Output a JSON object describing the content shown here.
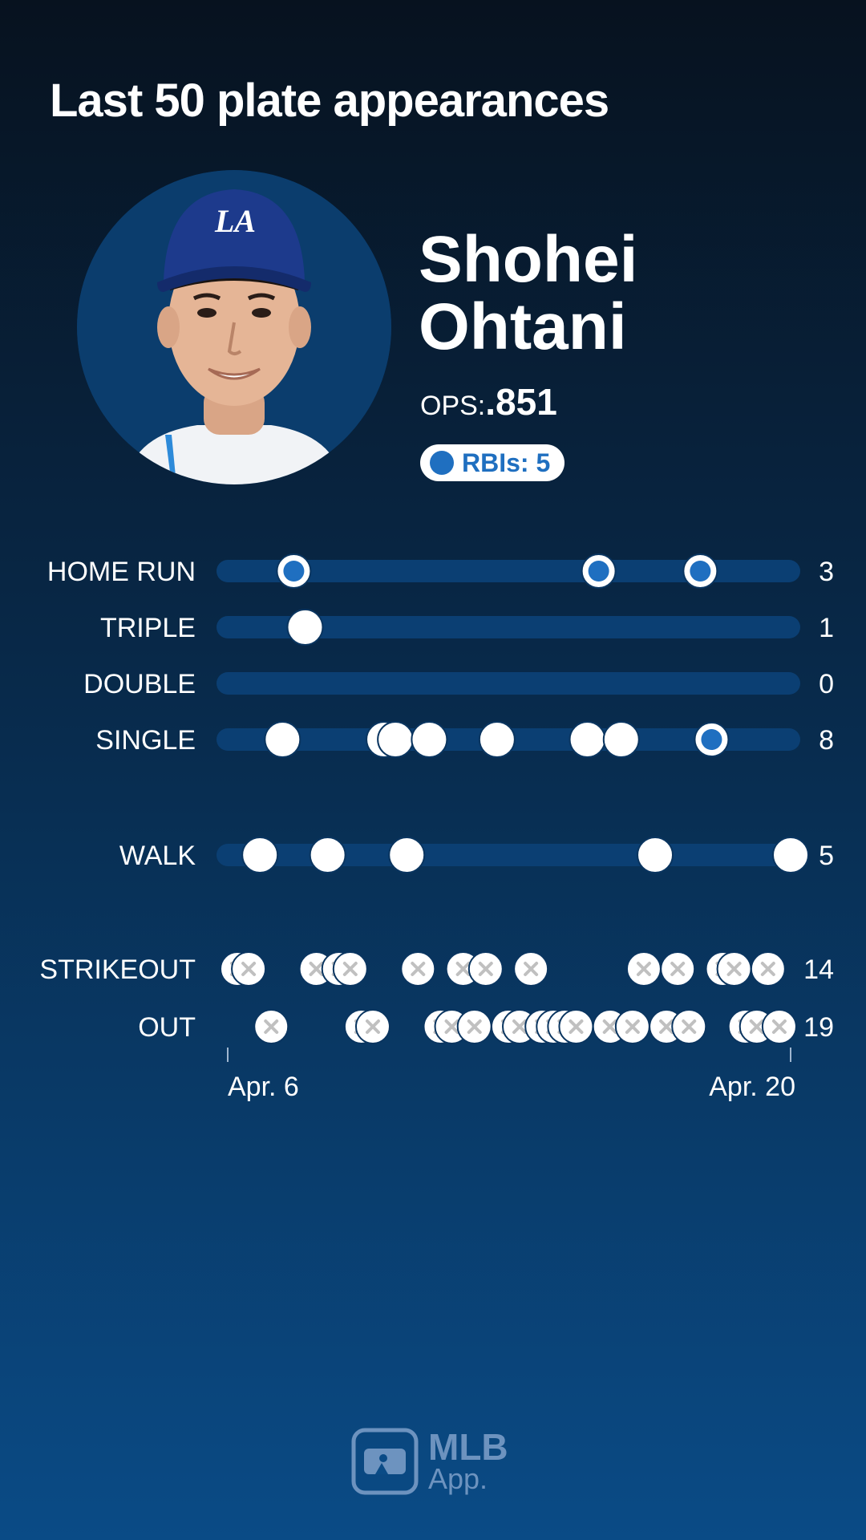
{
  "header": {
    "title": "Last 50 plate appearances"
  },
  "player": {
    "name": "Shohei Ohtani",
    "ops_label": "OPS:",
    "ops_value": ".851",
    "rbi_label": "RBIs: 5",
    "cap_logo_text": "LA"
  },
  "colors": {
    "rbi_blue": "#1f6fc0",
    "track": "#0b3f73",
    "marker": "#ffffff",
    "x_mark": "#c0c0c0"
  },
  "footer": {
    "logo_top": "MLB",
    "logo_bottom": "App."
  },
  "chart_data": {
    "type": "scatter",
    "title": "Last 50 plate appearances",
    "x_axis": {
      "type": "plate appearance",
      "min": 1,
      "max": 50,
      "start_label": "Apr. 6",
      "end_label": "Apr. 20"
    },
    "legend": {
      "rbi_marker": "RBIs: 5"
    },
    "categories": [
      {
        "label": "HOME RUN",
        "count": "3",
        "marker": "rbi",
        "points": [
          {
            "x": 6,
            "rbi": true
          },
          {
            "x": 33,
            "rbi": true
          },
          {
            "x": 42,
            "rbi": true
          }
        ]
      },
      {
        "label": "TRIPLE",
        "count": "1",
        "marker": "hit",
        "points": [
          {
            "x": 7,
            "rbi": false
          }
        ]
      },
      {
        "label": "DOUBLE",
        "count": "0",
        "marker": "hit",
        "points": []
      },
      {
        "label": "SINGLE",
        "count": "8",
        "marker": "hit",
        "points": [
          {
            "x": 5,
            "rbi": false
          },
          {
            "x": 14,
            "rbi": false
          },
          {
            "x": 15,
            "rbi": false
          },
          {
            "x": 18,
            "rbi": false
          },
          {
            "x": 24,
            "rbi": false
          },
          {
            "x": 32,
            "rbi": false
          },
          {
            "x": 35,
            "rbi": false
          },
          {
            "x": 43,
            "rbi": true
          }
        ]
      },
      {
        "label": "WALK",
        "count": "5",
        "marker": "hit",
        "points": [
          {
            "x": 3,
            "rbi": false
          },
          {
            "x": 9,
            "rbi": false
          },
          {
            "x": 16,
            "rbi": false
          },
          {
            "x": 38,
            "rbi": false
          },
          {
            "x": 50,
            "rbi": false
          }
        ]
      },
      {
        "label": "STRIKEOUT",
        "count": "14",
        "marker": "x",
        "points": [
          {
            "x": 1,
            "rbi": false
          },
          {
            "x": 2,
            "rbi": false
          },
          {
            "x": 8,
            "rbi": false
          },
          {
            "x": 10,
            "rbi": false
          },
          {
            "x": 11,
            "rbi": false
          },
          {
            "x": 17,
            "rbi": false
          },
          {
            "x": 21,
            "rbi": false
          },
          {
            "x": 23,
            "rbi": false
          },
          {
            "x": 27,
            "rbi": false
          },
          {
            "x": 37,
            "rbi": false
          },
          {
            "x": 40,
            "rbi": false
          },
          {
            "x": 44,
            "rbi": false
          },
          {
            "x": 45,
            "rbi": false
          },
          {
            "x": 48,
            "rbi": false
          }
        ]
      },
      {
        "label": "OUT",
        "count": "19",
        "marker": "x",
        "points": [
          {
            "x": 4,
            "rbi": false
          },
          {
            "x": 12,
            "rbi": false
          },
          {
            "x": 13,
            "rbi": false
          },
          {
            "x": 19,
            "rbi": false
          },
          {
            "x": 20,
            "rbi": false
          },
          {
            "x": 22,
            "rbi": false
          },
          {
            "x": 25,
            "rbi": false
          },
          {
            "x": 26,
            "rbi": false
          },
          {
            "x": 28,
            "rbi": false
          },
          {
            "x": 29,
            "rbi": false
          },
          {
            "x": 30,
            "rbi": false
          },
          {
            "x": 31,
            "rbi": false
          },
          {
            "x": 34,
            "rbi": false
          },
          {
            "x": 36,
            "rbi": false
          },
          {
            "x": 39,
            "rbi": false
          },
          {
            "x": 41,
            "rbi": false
          },
          {
            "x": 46,
            "rbi": false
          },
          {
            "x": 47,
            "rbi": false
          },
          {
            "x": 49,
            "rbi": false
          }
        ]
      }
    ]
  }
}
